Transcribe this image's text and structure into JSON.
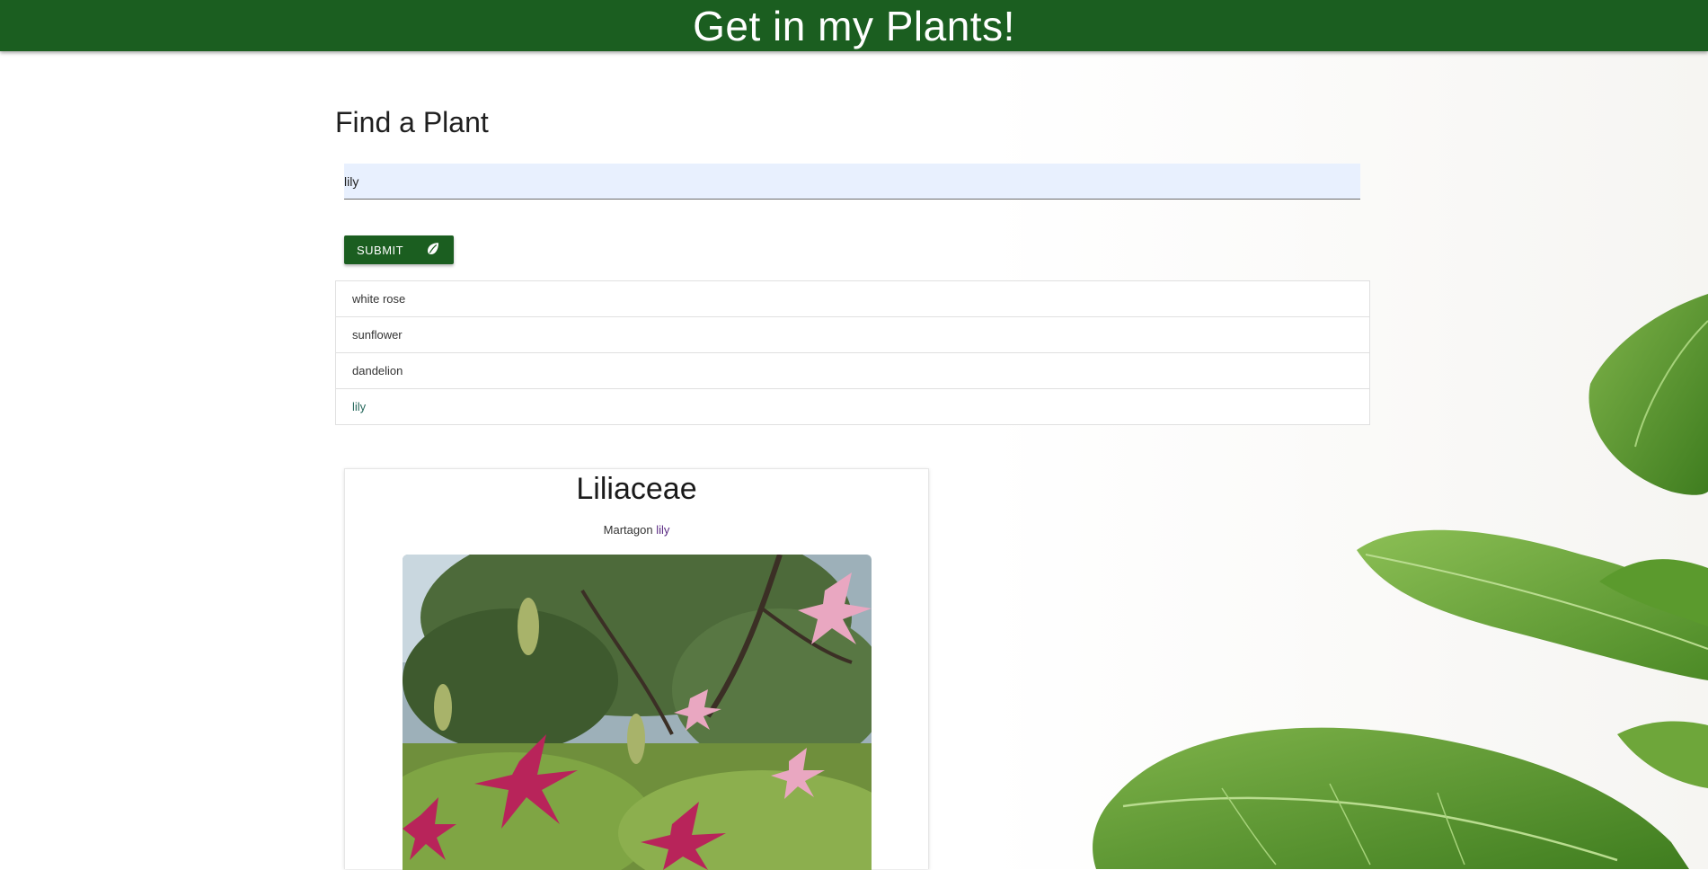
{
  "header": {
    "title": "Get in my Plants!"
  },
  "search": {
    "heading": "Find a Plant",
    "value": "lily",
    "submit_label": "SUBMIT"
  },
  "history": {
    "items": [
      {
        "label": "white rose"
      },
      {
        "label": "sunflower"
      },
      {
        "label": "dandelion"
      },
      {
        "label": "lily",
        "active": true
      }
    ]
  },
  "result": {
    "family": "Liliaceae",
    "common_name_prefix": "Martagon",
    "common_name_match": "lily",
    "image_icon": "lily-flowers-photo"
  },
  "colors": {
    "brand": "#1b5e20",
    "search_bg": "#e8f0fe",
    "active_link": "#26685c"
  },
  "icons": {
    "submit": "leaf-icon"
  }
}
